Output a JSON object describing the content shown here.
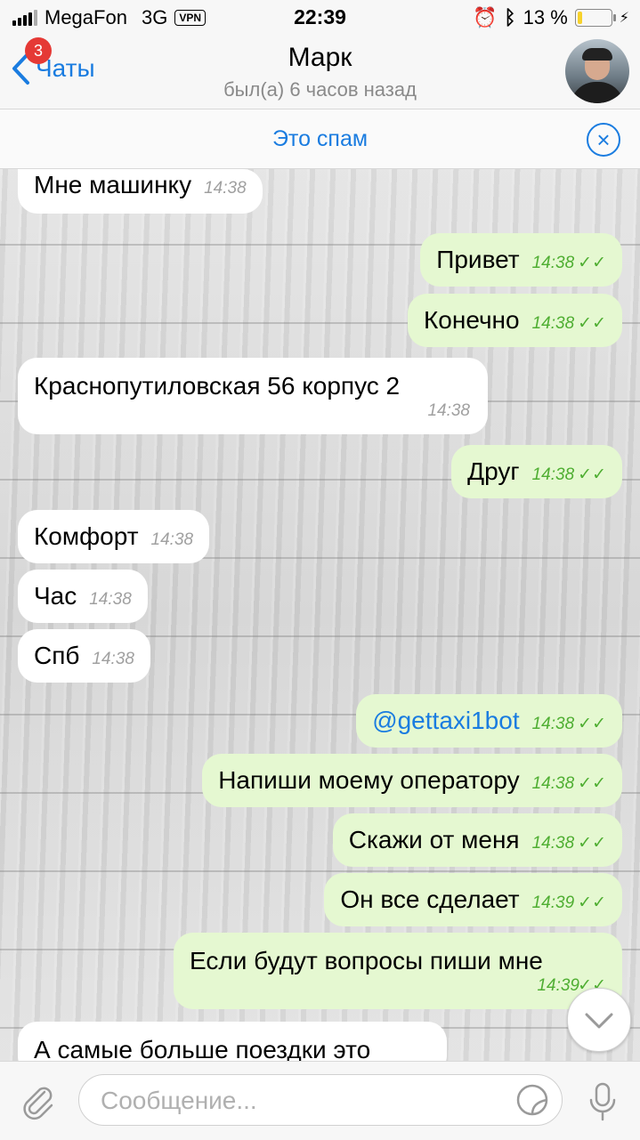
{
  "status_bar": {
    "carrier": "MegaFon",
    "network": "3G",
    "vpn": "VPN",
    "time": "22:39",
    "battery_percent": "13 %",
    "battery_level": 0.13
  },
  "header": {
    "back_label": "Чаты",
    "unread_badge": "3",
    "title": "Марк",
    "subtitle": "был(а) 6 часов назад"
  },
  "spam_bar": {
    "label": "Это спам"
  },
  "messages": [
    {
      "dir": "in",
      "text": "Мне машинку",
      "time": "14:38"
    },
    {
      "dir": "out",
      "text": "Привет",
      "time": "14:38"
    },
    {
      "dir": "out",
      "text": "Конечно",
      "time": "14:38"
    },
    {
      "dir": "in",
      "text": "Краснопутиловская 56 корпус 2",
      "time": "14:38"
    },
    {
      "dir": "out",
      "text": "Друг",
      "time": "14:38"
    },
    {
      "dir": "in",
      "text": "Комфорт",
      "time": "14:38"
    },
    {
      "dir": "in",
      "text": "Час",
      "time": "14:38"
    },
    {
      "dir": "in",
      "text": "Спб",
      "time": "14:38"
    },
    {
      "dir": "out",
      "text": "@gettaxi1bot",
      "time": "14:38"
    },
    {
      "dir": "out",
      "text": "Напиши моему оператору",
      "time": "14:38"
    },
    {
      "dir": "out",
      "text": "Скажи от меня",
      "time": "14:38"
    },
    {
      "dir": "out",
      "text": "Он все сделает",
      "time": "14:39"
    },
    {
      "dir": "out",
      "text": "Если будут вопросы пиши мне",
      "time": "14:39"
    },
    {
      "dir": "in",
      "text": "А самые больше поездки это",
      "time": ""
    }
  ],
  "input": {
    "placeholder": "Сообщение..."
  }
}
